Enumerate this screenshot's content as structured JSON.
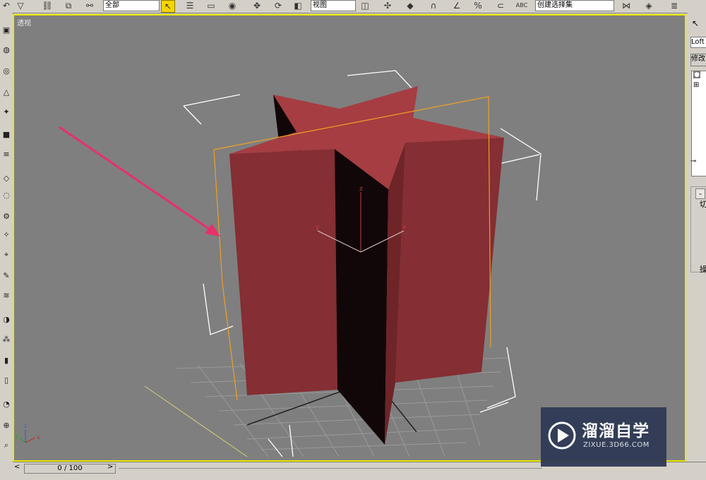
{
  "toolbar": {
    "selection_filter": "全部",
    "reference_coord": "视图",
    "named_selection": "创建选择集",
    "snap_abc": "ABC"
  },
  "viewport": {
    "label": "透视",
    "object_color": "#852e33",
    "shadow_color": "#120708",
    "background_color": "#7f7f7f",
    "border_color": "#e8e800",
    "gizmo_axes": {
      "z": "z",
      "x": "x",
      "y": "y"
    }
  },
  "right_panel": {
    "object_name": "Loft",
    "modifier_list": "修改",
    "rollout_minus": "-",
    "char1": "切",
    "char2": "操"
  },
  "timeline": {
    "frame_display": "0 / 100",
    "prev_arrow": "<",
    "next_arrow": ">"
  },
  "watermark": {
    "title": "溜溜自学",
    "subtitle": "ZIXUE.3D66.COM"
  },
  "icons": [
    "select-icon",
    "move-icon",
    "rotate-icon",
    "scale-icon",
    "snap-icon",
    "layer-icon",
    "lock-icon"
  ]
}
